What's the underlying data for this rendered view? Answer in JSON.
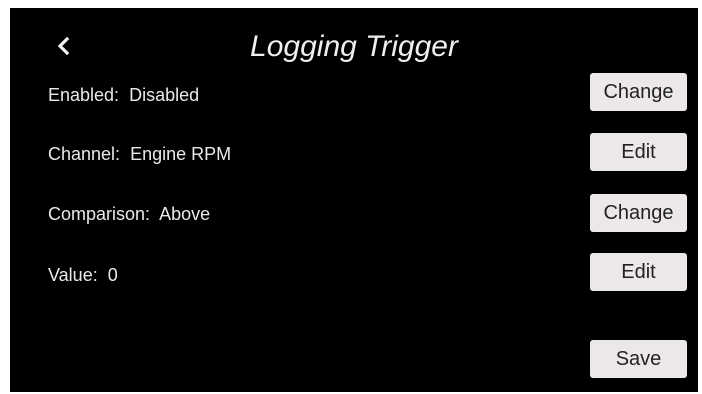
{
  "header": {
    "title": "Logging Trigger",
    "back_icon": "chevron-left-icon"
  },
  "rows": [
    {
      "label": "Enabled:",
      "value": "Disabled",
      "button": "Change"
    },
    {
      "label": "Channel:",
      "value": "Engine RPM",
      "button": "Edit"
    },
    {
      "label": "Comparison:",
      "value": "Above",
      "button": "Change"
    },
    {
      "label": "Value:",
      "value": "0",
      "button": "Edit"
    }
  ],
  "footer": {
    "save_label": "Save"
  },
  "colors": {
    "background": "#000000",
    "text": "#ececec",
    "button_bg": "#ece7ea",
    "button_text": "#222222"
  }
}
